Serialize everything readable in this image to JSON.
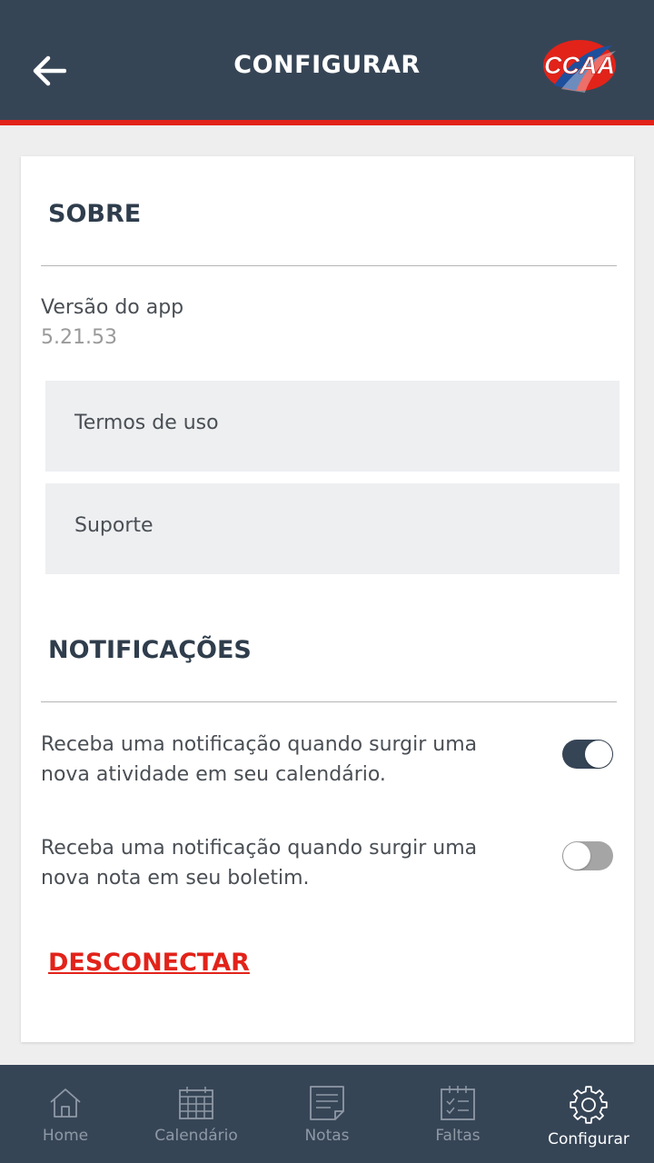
{
  "header": {
    "title": "CONFIGURAR",
    "back_icon": "arrow-left-icon",
    "logo_text": "CCAA"
  },
  "about": {
    "title": "SOBRE",
    "version_label": "Versão do app",
    "version_value": "5.21.53",
    "terms_label": "Termos de uso",
    "support_label": "Suporte"
  },
  "notifications": {
    "title": "NOTIFICAÇÕES",
    "calendar_text": "Receba uma notificação quando surgir uma nova atividade em seu calendário.",
    "calendar_enabled": true,
    "grades_text": "Receba uma notificação quando surgir uma nova nota em seu boletim.",
    "grades_enabled": false
  },
  "disconnect_label": "DESCONECTAR",
  "nav": {
    "items": [
      {
        "label": "Home",
        "icon": "home-icon"
      },
      {
        "label": "Calendário",
        "icon": "calendar-icon"
      },
      {
        "label": "Notas",
        "icon": "document-icon"
      },
      {
        "label": "Faltas",
        "icon": "checklist-icon"
      },
      {
        "label": "Configurar",
        "icon": "gear-icon",
        "active": true
      }
    ]
  },
  "colors": {
    "primary": "#364556",
    "accent": "#e2231a",
    "background": "#eeeeee"
  }
}
